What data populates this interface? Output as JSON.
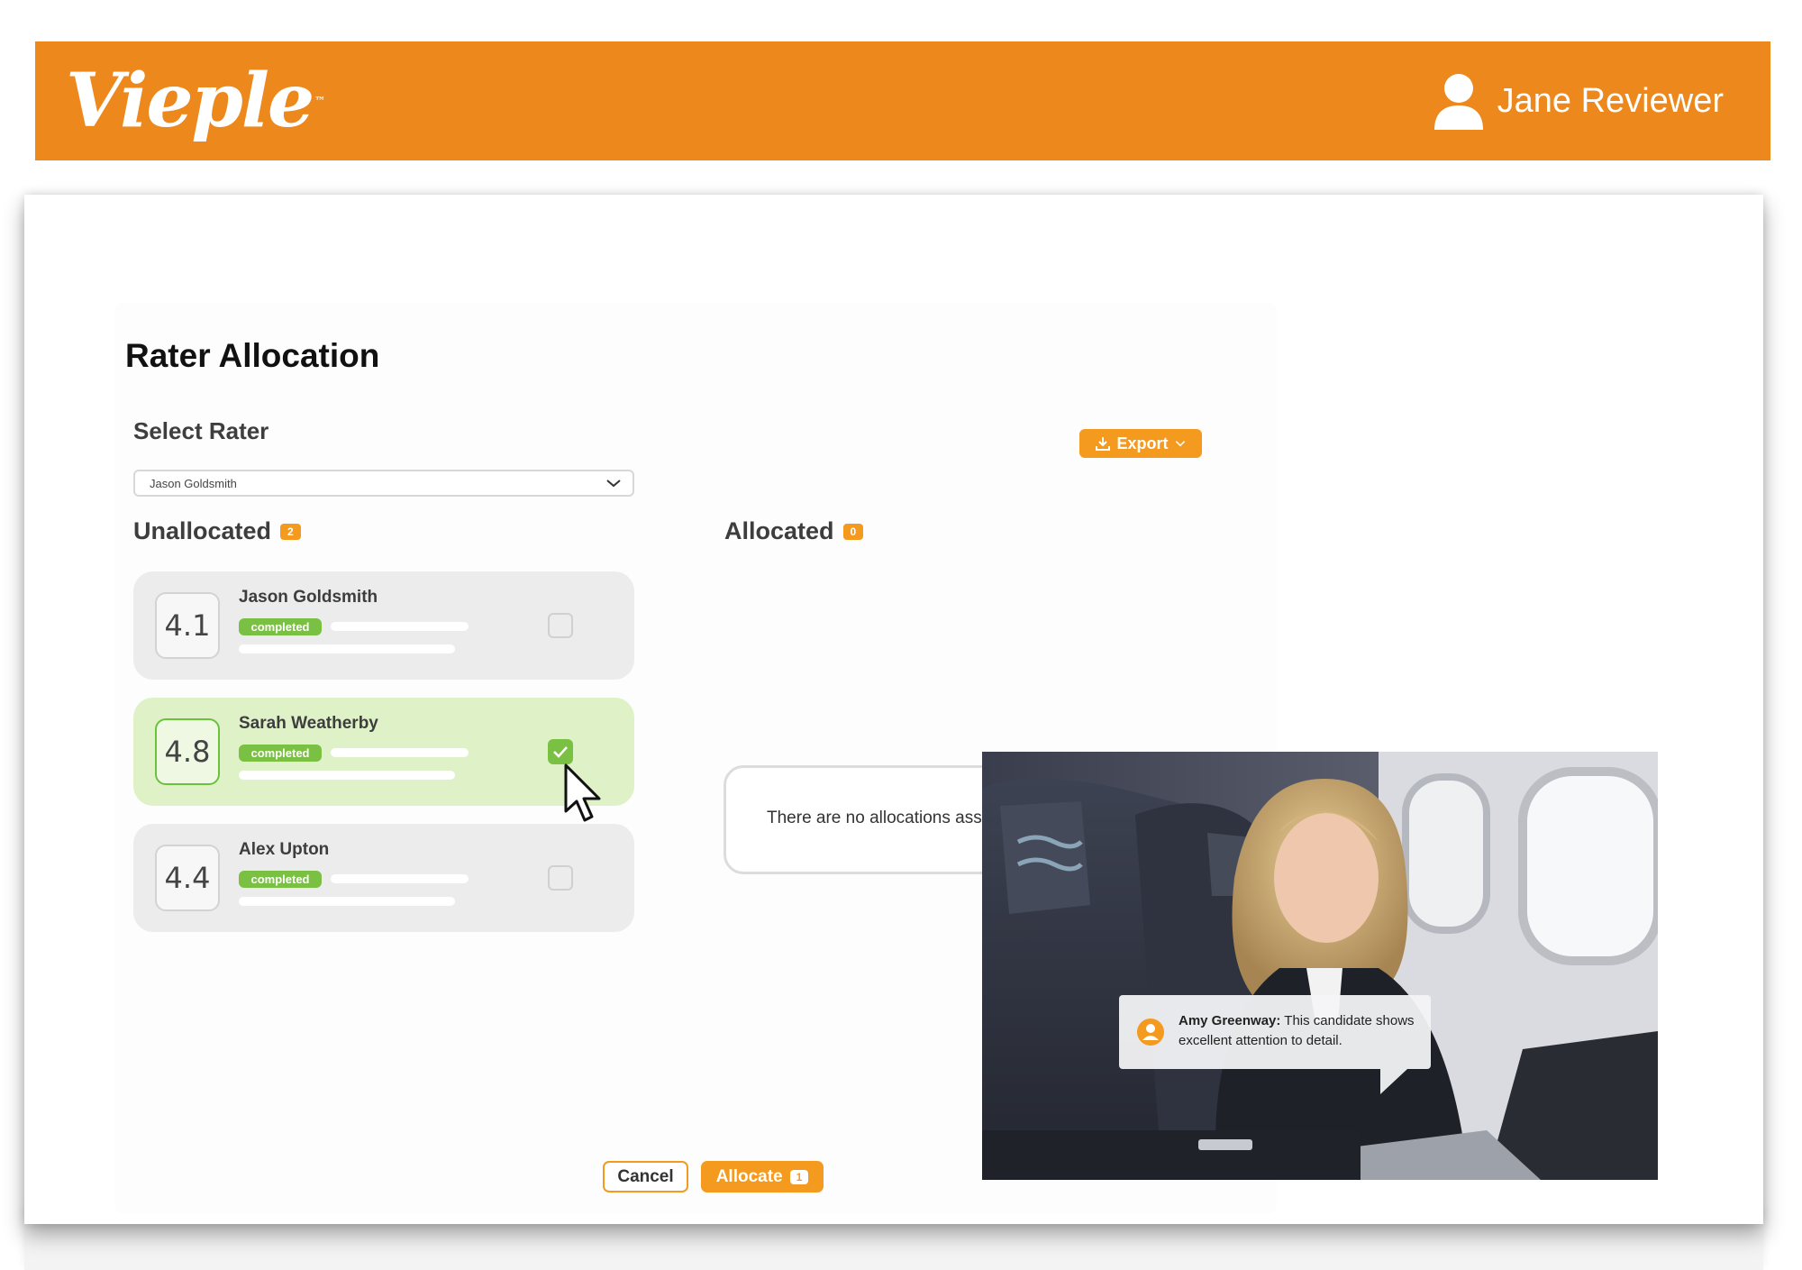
{
  "header": {
    "brand": "Vieple",
    "brand_mark": "™",
    "user_name": "Jane Reviewer",
    "brand_color": "#ec881c"
  },
  "page": {
    "title": "Rater Allocation",
    "select_label": "Select Rater",
    "selected_rater": "Jason Goldsmith",
    "export_label": "Export"
  },
  "unallocated": {
    "label": "Unallocated",
    "count": "2",
    "candidates": [
      {
        "score": "4.1",
        "name": "Jason Goldsmith",
        "status": "completed",
        "checked": false
      },
      {
        "score": "4.8",
        "name": "Sarah Weatherby",
        "status": "completed",
        "checked": true
      },
      {
        "score": "4.4",
        "name": "Alex Upton",
        "status": "completed",
        "checked": false
      }
    ]
  },
  "allocated": {
    "label": "Allocated",
    "count": "0",
    "empty_message": "There are no allocations assigned"
  },
  "actions": {
    "cancel_label": "Cancel",
    "allocate_label": "Allocate",
    "allocate_count": "1"
  },
  "video": {
    "comment_author": "Amy Greenway:",
    "comment_text": "This candidate shows excellent attention to detail."
  },
  "colors": {
    "accent": "#f39a1f",
    "completed": "#7ac143",
    "selected_row": "#dff1c7"
  }
}
